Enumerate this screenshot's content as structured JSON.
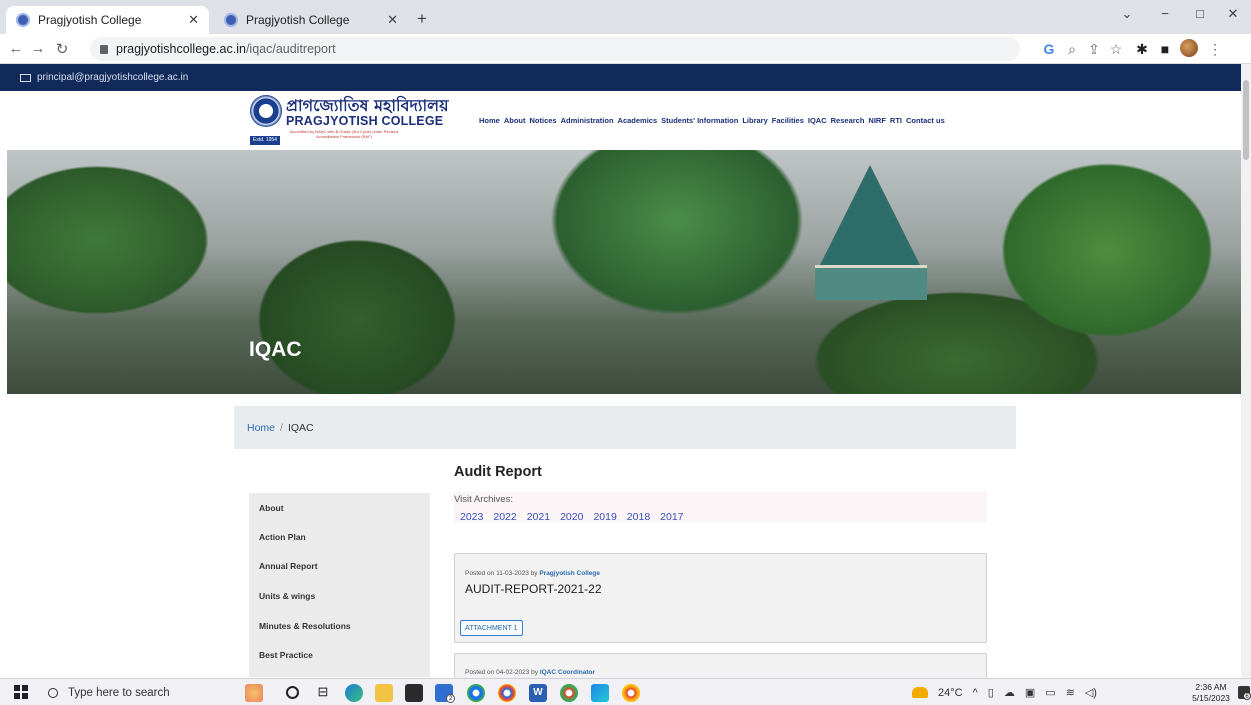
{
  "browser": {
    "tabs": [
      {
        "title": "Pragjyotish College"
      },
      {
        "title": "Pragjyotish College"
      }
    ],
    "new_tab": "+",
    "url_host": "pragjyotishcollege.ac.in",
    "url_path": "/iqac/auditreport",
    "window": {
      "minimize": "−",
      "maximize": "□",
      "close": "✕",
      "menu": "⌄"
    }
  },
  "site": {
    "email": "principal@pragjyotishcollege.ac.in",
    "logo": {
      "bengali_name": "প্ৰাগজ্যোতিষ মহাবিদ্যালয়",
      "english_name": "PRAGJYOTISH COLLEGE",
      "tagline": "Accredited by NAAC with B Grade (3rd Cycle) under Revised Accreditation Framework (RAF)",
      "estd": "Estd. 1954"
    },
    "nav": [
      "Home",
      "About",
      "Notices",
      "Administration",
      "Academics",
      "Students' Information",
      "Library",
      "Facilities",
      "IQAC",
      "Research",
      "NIRF",
      "RTI",
      "Contact us"
    ],
    "hero_title": "IQAC",
    "breadcrumb": {
      "home": "Home",
      "separator": "/",
      "current": "IQAC"
    }
  },
  "sidebar": {
    "items": [
      "About",
      "Action Plan",
      "Annual Report",
      "Units & wings",
      "Minutes & Resolutions",
      "Best Practice"
    ]
  },
  "content": {
    "title": "Audit Report",
    "archives_label": "Visit Archives:",
    "archive_years": [
      "2023",
      "2022",
      "2021",
      "2020",
      "2019",
      "2018",
      "2017"
    ],
    "posts": [
      {
        "posted_prefix": "Posted on 11-03-2023 by ",
        "author": "Pragjyotish College",
        "title": "AUDIT-REPORT-2021-22",
        "attachment": "ATTACHMENT 1"
      },
      {
        "posted_prefix": "Posted on 04-02-2023 by ",
        "author": "IQAC Coordinator"
      }
    ]
  },
  "taskbar": {
    "search_placeholder": "Type here to search",
    "weather": "24°C",
    "time": "2:36 AM",
    "date": "5/15/2023",
    "notification_count": "6",
    "mail_badge": "2"
  },
  "colors": {
    "brand_navy": "#122a5a",
    "link_blue": "#2b6cb0"
  }
}
